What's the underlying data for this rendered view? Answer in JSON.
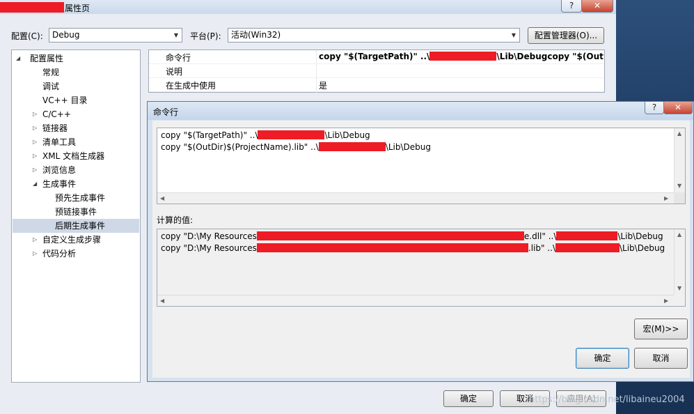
{
  "main_window": {
    "title": "属性页",
    "config_label": "配置(C):",
    "config_value": "Debug",
    "platform_label": "平台(P):",
    "platform_value": "活动(Win32)",
    "config_manager_button": "配置管理器(O)...",
    "caption_help": "?",
    "caption_close": "✕",
    "ok_button": "确定",
    "cancel_button": "取消",
    "apply_button": "应用(A)"
  },
  "tree": {
    "root": "配置属性",
    "items": {
      "general": "常规",
      "debugging": "调试",
      "vc_dirs": "VC++ 目录",
      "c_cpp": "C/C++",
      "linker": "链接器",
      "manifest": "清单工具",
      "xml_doc": "XML 文档生成器",
      "browse": "浏览信息",
      "build_events": "生成事件",
      "pre_build": "预先生成事件",
      "pre_link": "预链接事件",
      "post_build": "后期生成事件",
      "custom_build": "自定义生成步骤",
      "code_analysis": "代码分析"
    }
  },
  "properties": {
    "rows": [
      {
        "name": "命令行",
        "value_a": "copy \"$(TargetPath)\" ..\\",
        "value_b": "\\Lib\\Debugcopy \"$(OutDir)"
      },
      {
        "name": "说明",
        "value_a": "",
        "value_b": ""
      },
      {
        "name": "在生成中使用",
        "value_a": "是",
        "value_b": ""
      }
    ]
  },
  "dialog": {
    "title": "命令行",
    "caption_help": "?",
    "caption_close": "✕",
    "command_lines": [
      {
        "before": "copy \"$(TargetPath)\" ..\\",
        "after": "\\Lib\\Debug"
      },
      {
        "before": "copy \"$(OutDir)$(ProjectName).lib\" ..\\",
        "after": "\\Lib\\Debug"
      }
    ],
    "evaluated_label": "计算的值:",
    "evaluated_lines": [
      {
        "before": "copy \"D:\\My Resources",
        "mid": "e.dll\" ..\\",
        "after": "\\Lib\\Debug"
      },
      {
        "before": "copy \"D:\\My Resources",
        "mid": ".lib\" ..\\",
        "after": "\\Lib\\Debug"
      }
    ],
    "macros_button": "宏(M)>>",
    "ok_button": "确定",
    "cancel_button": "取消"
  },
  "watermark": "https://blog.csdn.net/libaineu2004",
  "colors": {
    "redaction": "#ee1c25",
    "selected_row": "#cfd8e6",
    "dialog_frame": "#d7e2ef"
  }
}
